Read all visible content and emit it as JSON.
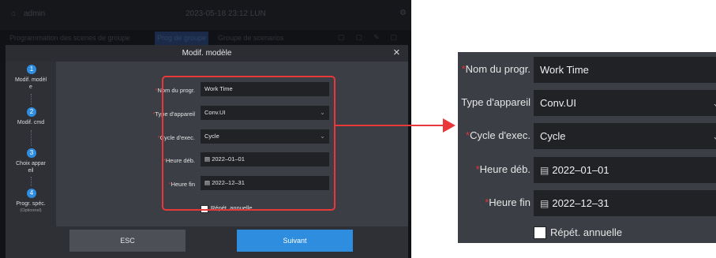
{
  "background_screen": {
    "user": "admin",
    "clock": "2023-05-18 23:12 LUN",
    "menu": [
      "Programmation des scenes de groupe",
      "Prog de groupe",
      "Groupe de scenarios"
    ]
  },
  "modal": {
    "title": "Modif. modèle",
    "close_icon": "×",
    "steps": [
      {
        "number": "1",
        "label": "Modif. modèl\ne"
      },
      {
        "number": "2",
        "label": "Modif. cmd"
      },
      {
        "number": "3",
        "label": "Choix appar\neil"
      },
      {
        "number": "4",
        "label": "Progr. spéc.",
        "sublabel": "(Optionnel)"
      }
    ],
    "fields": {
      "name": {
        "label": "Nom du progr.",
        "value": "Work Time"
      },
      "device_type": {
        "label": "Type d'appareil",
        "value": "Conv.UI"
      },
      "cycle": {
        "label": "Cycle d'exec.",
        "value": "Cycle"
      },
      "start_time": {
        "label": "Heure déb.",
        "value": "2022–01–01"
      },
      "end_time": {
        "label": "Heure fin",
        "value": "2022–12–31"
      }
    },
    "repeat_checkbox": {
      "label": "Répét. annuelle",
      "checked": false
    },
    "footer": {
      "esc_label": "ESC",
      "next_label": "Suivant"
    }
  },
  "zoom_panel": {
    "fields": {
      "name": {
        "label": "Nom du progr.",
        "value": "Work Time"
      },
      "device_type": {
        "label": "Type d'appareil",
        "value": "Conv.UI"
      },
      "cycle": {
        "label": "Cycle d'exec.",
        "value": "Cycle"
      },
      "start_time": {
        "label": "Heure déb.",
        "value": "2022–01–01"
      },
      "end_time": {
        "label": "Heure fin",
        "value": "2022–12–31"
      }
    },
    "repeat_checkbox": {
      "label": "Répét. annuelle"
    }
  },
  "icons": {
    "required_marker": "asterisk-icon",
    "dropdown": "chevron-down-icon",
    "date": "calendar-icon",
    "close": "close-icon"
  },
  "colors": {
    "accent_blue": "#2f8de0",
    "highlight_red": "#e8383a",
    "required_red": "#e0363a",
    "modal_bg": "#3b3e45",
    "field_bg": "#202226"
  }
}
